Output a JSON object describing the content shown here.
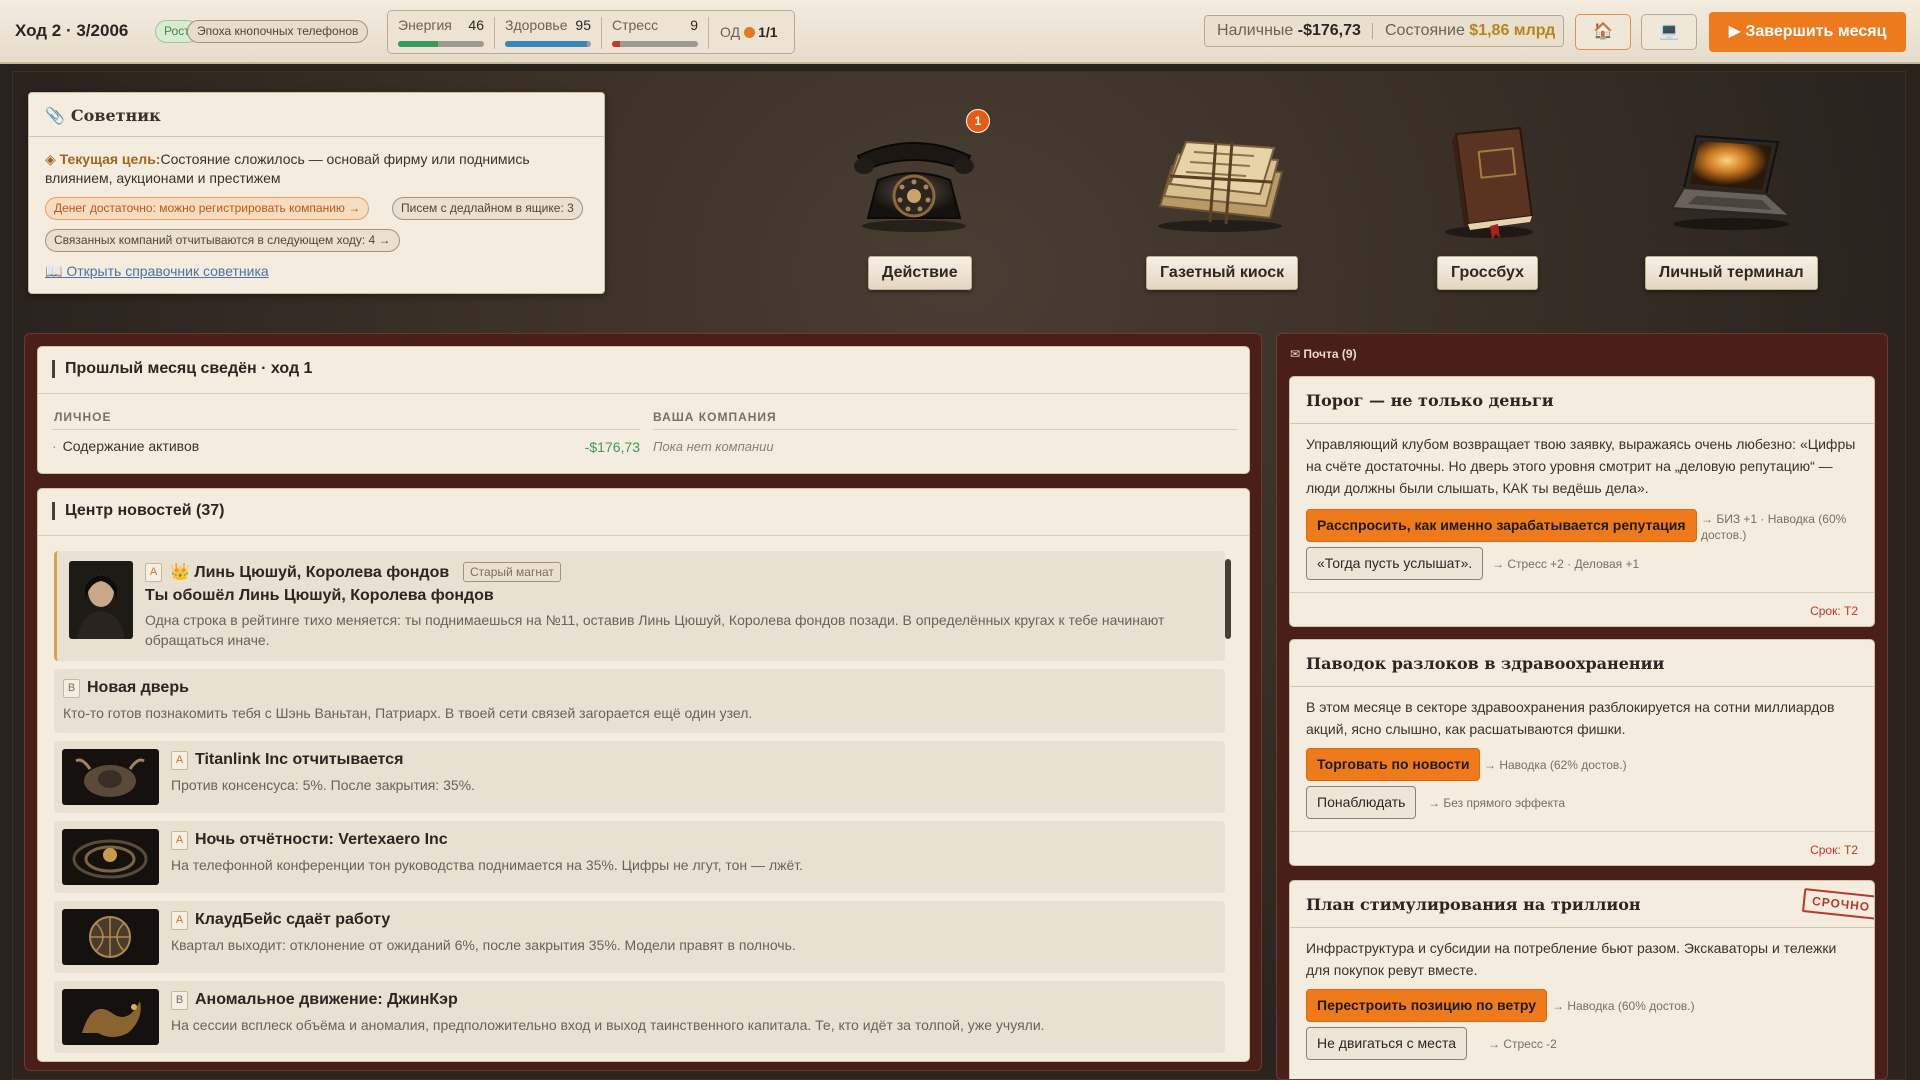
{
  "topbar": {
    "turn": "Ход 2 · 3/2006",
    "phase": "Рост",
    "era": "Эпоха кнопочных телефонов",
    "stats": [
      {
        "label": "Энергия",
        "value": "46",
        "level": 0.46,
        "color": "#3a9a5b"
      },
      {
        "label": "Здоровье",
        "value": "95",
        "level": 0.95,
        "color": "#3a86b8"
      },
      {
        "label": "Стресс",
        "value": "9",
        "level": 0.09,
        "color": "#c0392b"
      }
    ],
    "od_label": "ОД",
    "od_value": "1/1",
    "cash_label": "Наличные",
    "cash_value": "-$176,73",
    "worth_label": "Состояние",
    "worth_value": "$1,86 млрд",
    "home_icon": "🏠",
    "pc_icon": "💻",
    "end_label": "▶ Завершить месяц"
  },
  "advisor": {
    "title": "Советник",
    "goal_label": "◈ Текущая цель:",
    "goal_text": "Состояние сложилось — основай фирму или поднимись влиянием, аукционами и престижем",
    "chips": [
      "Денег достаточно: можно регистрировать компанию →",
      "Писем с дедлайном в ящике: 3",
      "Связанных компаний отчитываются в следующем ходу: 4 →"
    ],
    "link": "📖 Открыть справочник советника"
  },
  "stations": {
    "badge": "1",
    "labels": [
      "Действие",
      "Газетный киоск",
      "Гроссбух",
      "Личный терминал"
    ]
  },
  "summary": {
    "title": "Прошлый месяц сведён · ход 1",
    "col_personal": "ЛИЧНОЕ",
    "col_company": "ВАША КОМПАНИЯ",
    "row_label": "Содержание активов",
    "row_value": "-$176,73",
    "no_company": "Пока нет компании"
  },
  "news": {
    "title": "Центр новостей (37)",
    "items": [
      {
        "tag": "A",
        "title": "👑 Линь Цюшуй, Королева фондов",
        "chip": "Старый магнат",
        "subtitle": "Ты обошёл Линь Цюшуй, Королева фондов",
        "text": "Одна строка в рейтинге тихо меняется: ты поднимаешься на №11, оставив Линь Цюшуй, Королева фондов позади. В определённых кругах к тебе начинают обращаться иначе."
      },
      {
        "tag": "B",
        "title": "Новая дверь",
        "text": "Кто-то готов познакомить тебя с Шэнь Ваньтан, Патриарх. В твоей сети связей загорается ещё один узел."
      },
      {
        "tag": "A",
        "title": "Titanlink Inc отчитывается",
        "text": "Против консенсуса: 5%. После закрытия: 35%."
      },
      {
        "tag": "A",
        "title": "Ночь отчётности: Vertexaero Inc",
        "text": "На телефонной конференции тон руководства поднимается на 35%. Цифры не лгут, тон — лжёт."
      },
      {
        "tag": "A",
        "title": "КлаудБейс сдаёт работу",
        "text": "Квартал выходит: отклонение от ожиданий 6%, после закрытия 35%. Модели правят в полночь."
      },
      {
        "tag": "B",
        "title": "Аномальное движение: ДжинКэр",
        "text": "На сессии всплеск объёма и аномалия, предположительно вход и выход таинственного капитала. Те, кто идёт за толпой, уже учуяли."
      }
    ]
  },
  "mail": {
    "header": "✉ Почта (9)",
    "letters": [
      {
        "title": "Порог — не только деньги",
        "text": "Управляющий клубом возвращает твою заявку, выражаясь очень любезно: «Цифры на счёте достаточны. Но дверь этого уровня смотрит на „деловую репутацию“ — люди должны были слышать, КАК ты ведёшь дела».",
        "primary": "Расспросить, как именно зарабатывается репутация",
        "primary_effect": "→ БИЗ +1 · Наводка (60% достов.)",
        "secondary": "«Тогда пусть услышат».",
        "secondary_effect": "→ Стресс +2 · Деловая +1",
        "deadline": "Срок: T2"
      },
      {
        "title": "Паводок разлоков в здравоохранении",
        "text": "В этом месяце в секторе здравоохранения разблокируется на сотни миллиардов акций, ясно слышно, как расшатываются фишки.",
        "primary": "Торговать по новости",
        "primary_effect": "→ Наводка (62% достов.)",
        "secondary": "Понаблюдать",
        "secondary_effect": "→ Без прямого эффекта",
        "deadline": "Срок: T2"
      },
      {
        "title": "План стимулирования на триллион",
        "urgent": "СРОЧНО",
        "text": "Инфраструктура и субсидии на потребление бьют разом. Экскаваторы и тележки для покупок ревут вместе.",
        "primary": "Перестроить позицию по ветру",
        "primary_effect": "→ Наводка (60% достов.)",
        "secondary": "Не двигаться с места",
        "secondary_effect": "→ Стресс -2"
      }
    ]
  }
}
